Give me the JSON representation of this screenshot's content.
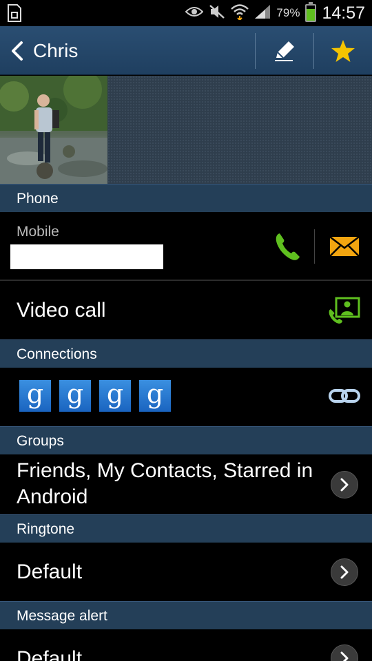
{
  "status_bar": {
    "battery_percent": "79%",
    "battery_level": 0.79,
    "time": "14:57",
    "icons": [
      "sim-card-icon",
      "eye-icon",
      "mute-icon",
      "wifi-icon",
      "signal-icon",
      "battery-icon"
    ]
  },
  "header": {
    "title": "Chris",
    "icons": [
      "back-icon",
      "edit-icon",
      "star-icon"
    ]
  },
  "sections": {
    "phone": "Phone",
    "connections": "Connections",
    "groups": "Groups",
    "ringtone": "Ringtone",
    "message_alert": "Message alert"
  },
  "phone": {
    "type_label": "Mobile",
    "icons": [
      "call-icon",
      "message-icon"
    ]
  },
  "video_call": {
    "label": "Video call",
    "icon": "video-call-icon"
  },
  "connections": {
    "accounts": [
      "g",
      "g",
      "g",
      "g"
    ],
    "link_icon": "link-icon"
  },
  "groups": {
    "value": "Friends, My Contacts, Starred in Android"
  },
  "ringtone": {
    "value": "Default"
  },
  "message_alert": {
    "value": "Default"
  },
  "colors": {
    "action_bar": "#2a4e72",
    "section_header": "#243f58",
    "call_green": "#5fbf1f",
    "message_orange": "#f2a510",
    "star_yellow": "#f5c400",
    "google_blue": "#1a64c0"
  }
}
